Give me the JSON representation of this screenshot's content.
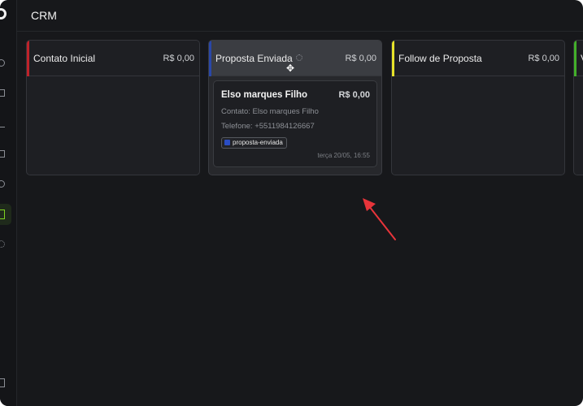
{
  "header": {
    "title": "CRM"
  },
  "sidebar": {
    "icons": [
      "dashboard-icon",
      "contacts-icon",
      "analytics-icon",
      "campaigns-icon",
      "users-icon",
      "crm-board-icon",
      "settings-icon",
      "device-icon"
    ],
    "active": "crm-board-icon",
    "accent_color": "#7ed321"
  },
  "columns": [
    {
      "name": "Contato Inicial",
      "total": "R$ 0,00",
      "accent": "#c0222a"
    },
    {
      "name": "Proposta Enviada",
      "total": "R$ 0,00",
      "accent": "#2a47a8"
    },
    {
      "name": "Follow de Proposta",
      "total": "R$ 0,00",
      "accent": "#e6e22a"
    },
    {
      "name": "V",
      "total": "",
      "accent": "#43b02a"
    }
  ],
  "card": {
    "name": "Elso marques Filho",
    "value": "R$ 0,00",
    "contact": "Contato: Elso marques Filho",
    "phone": "Telefone: +5511984126667",
    "tag": "proposta-enviada",
    "tag_color": "#2a4dc4",
    "date": "terça 20/05, 16:55"
  },
  "annotation": {
    "arrow_color": "#e8343a"
  }
}
